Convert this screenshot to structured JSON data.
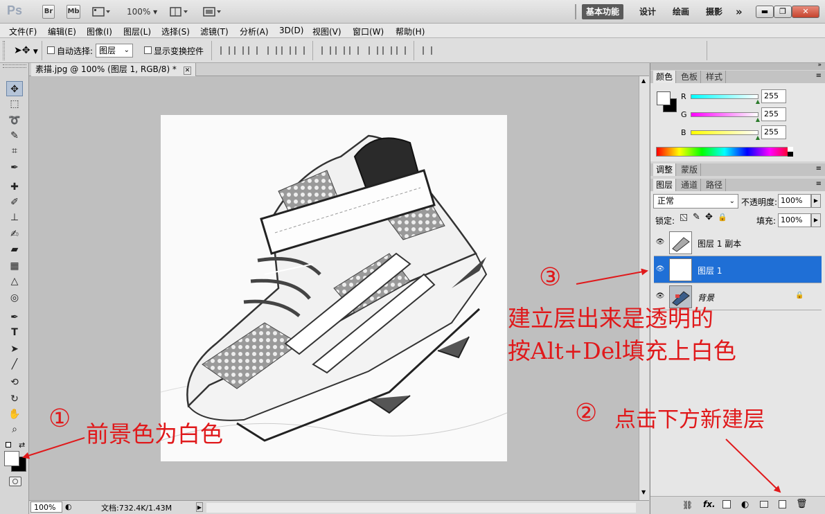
{
  "titlebar": {
    "app_logo": "Ps",
    "bridge_btn": "Br",
    "mini_bridge_btn": "Mb",
    "zoom": "100%",
    "workspaces": [
      "基本功能",
      "设计",
      "绘画",
      "摄影"
    ],
    "more": "»"
  },
  "menubar": {
    "items": [
      "文件(F)",
      "编辑(E)",
      "图像(I)",
      "图层(L)",
      "选择(S)",
      "滤镜(T)",
      "分析(A)",
      "3D(D)",
      "视图(V)",
      "窗口(W)",
      "帮助(H)"
    ]
  },
  "options_bar": {
    "auto_select_label": "自动选择:",
    "auto_select_value": "图层",
    "show_transform_label": "显示变换控件"
  },
  "document": {
    "tab_title": "素描.jpg @ 100% (图层 1, RGB/8) *",
    "close_glyph": "✕"
  },
  "statusbar": {
    "zoom": "100%",
    "doc_info": "文档:732.4K/1.43M"
  },
  "color_panel": {
    "tabs": [
      "颜色",
      "色板",
      "样式"
    ],
    "channels": [
      {
        "label": "R",
        "value": "255"
      },
      {
        "label": "G",
        "value": "255"
      },
      {
        "label": "B",
        "value": "255"
      }
    ]
  },
  "adjust_panel": {
    "tabs": [
      "调整",
      "蒙版"
    ]
  },
  "layers_panel": {
    "tabs": [
      "图层",
      "通道",
      "路径"
    ],
    "blend_mode": "正常",
    "opacity_label": "不透明度:",
    "opacity_value": "100%",
    "lock_label": "锁定:",
    "fill_label": "填充:",
    "fill_value": "100%",
    "layers": [
      {
        "name": "图层 1 副本",
        "selected": false
      },
      {
        "name": "图层 1",
        "selected": true
      },
      {
        "name": "背景",
        "selected": false
      }
    ]
  },
  "annotations": {
    "step1_num": "①",
    "step1_text": "前景色为白色",
    "step2_num": "②",
    "step2_text": "点击下方新建层",
    "step3_num": "③",
    "step3_line1": "建立层出来是透明的",
    "step3_line2": "按Alt+Del填充上白色"
  },
  "colors": {
    "accent_red": "#e0191b",
    "selected_layer": "#3875d7",
    "foreground": "#ffffff",
    "background": "#000000"
  }
}
